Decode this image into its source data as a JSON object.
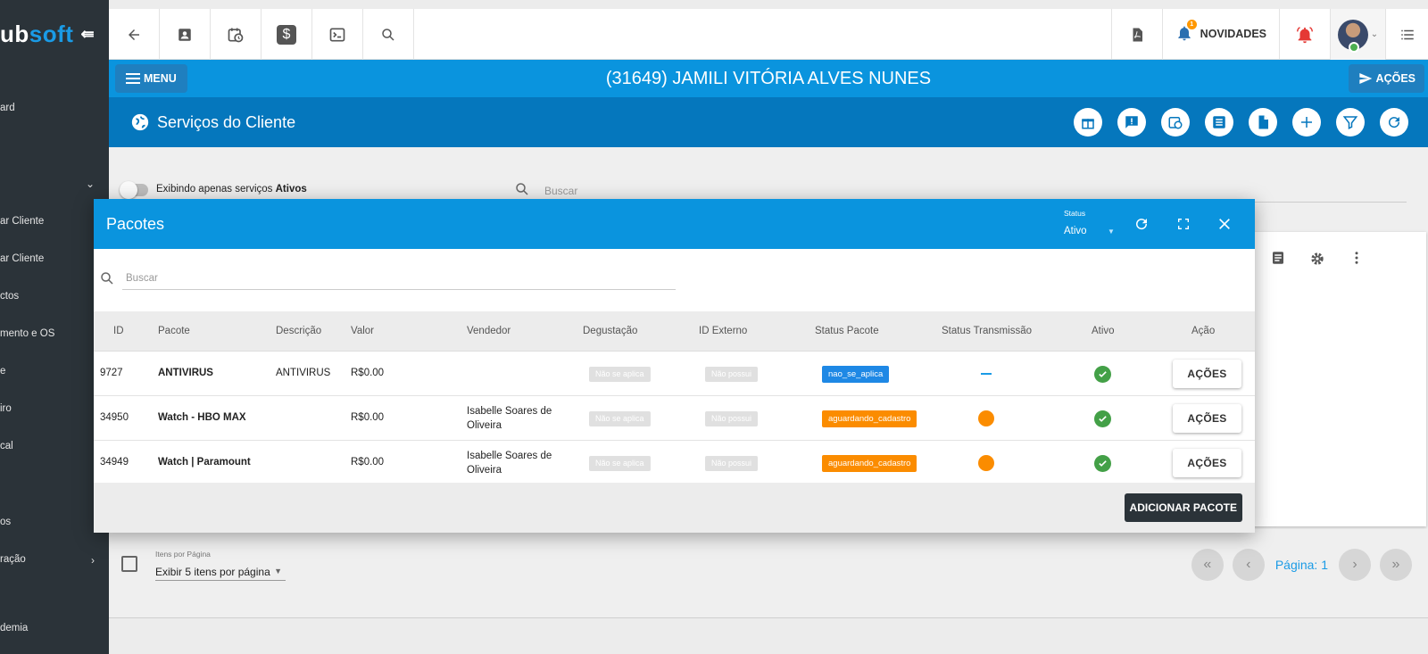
{
  "brand": {
    "logo_white": "ub",
    "logo_blue": "soft",
    "collapse_icon": "collapse-menu-icon"
  },
  "sidebar": {
    "items": [
      {
        "label": "ard"
      },
      {
        "label": "ar Cliente"
      },
      {
        "label": "ar Cliente"
      },
      {
        "label": "ctos"
      },
      {
        "label": "mento e OS"
      },
      {
        "label": "e"
      },
      {
        "label": "iro"
      },
      {
        "label": "cal"
      },
      {
        "label": "os"
      },
      {
        "label": "ração"
      },
      {
        "label": "demia"
      }
    ]
  },
  "topbar": {
    "news_label": "NOVIDADES",
    "news_badge": "1"
  },
  "client": {
    "menu_label": "MENU",
    "name": "(31649) JAMILI VITÓRIA ALVES NUNES",
    "actions_label": "AÇÕES"
  },
  "services": {
    "title": "Serviços do Cliente",
    "toggle_text": "Exibindo apenas serviços ",
    "toggle_bold": "Ativos",
    "search_placeholder": "Buscar"
  },
  "pagination": {
    "per_page_label": "Itens por Página",
    "per_page_value": "Exibir 5 itens por página",
    "page_label": "Página: 1"
  },
  "modal": {
    "title": "Pacotes",
    "status_label": "Status",
    "status_value": "Ativo",
    "search_placeholder": "Buscar",
    "columns": [
      "ID",
      "Pacote",
      "Descrição",
      "Valor",
      "Vendedor",
      "Degustação",
      "ID Externo",
      "Status Pacote",
      "Status Transmissão",
      "Ativo",
      "Ação"
    ],
    "rows": [
      {
        "id": "9727",
        "pacote": "ANTIVIRUS",
        "descricao": "ANTIVIRUS",
        "valor": "R$0.00",
        "vendedor": "",
        "degustacao": "Não se aplica",
        "id_externo": "Não possui",
        "status_pacote": "nao_se_aplica",
        "status_color": "#1e88e5",
        "transmissao": "none",
        "ativo": true,
        "acao": "AÇÕES"
      },
      {
        "id": "34950",
        "pacote": "Watch - HBO MAX",
        "descricao": "",
        "valor": "R$0.00",
        "vendedor": "Isabelle Soares de Oliveira",
        "degustacao": "Não se aplica",
        "id_externo": "Não possui",
        "status_pacote": "aguardando_cadastro",
        "status_color": "#fb8c00",
        "transmissao": "pending",
        "ativo": true,
        "acao": "AÇÕES"
      },
      {
        "id": "34949",
        "pacote": "Watch | Paramount",
        "descricao": "",
        "valor": "R$0.00",
        "vendedor": "Isabelle Soares de Oliveira",
        "degustacao": "Não se aplica",
        "id_externo": "Não possui",
        "status_pacote": "aguardando_cadastro",
        "status_color": "#fb8c00",
        "transmissao": "pending",
        "ativo": true,
        "acao": "AÇÕES"
      }
    ],
    "add_label": "ADICIONAR PACOTE"
  }
}
